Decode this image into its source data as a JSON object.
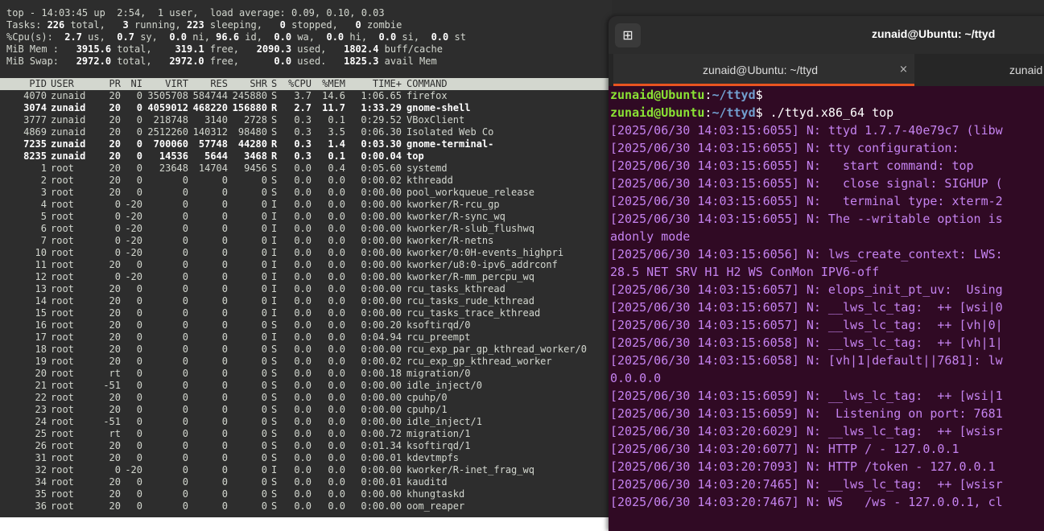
{
  "top": {
    "header_lines": [
      "top - 14:03:45 up  2:54,  1 user,  load average: 0.09, 0.10, 0.03",
      "Tasks: 226 total,   3 running, 223 sleeping,   0 stopped,   0 zombie",
      "%Cpu(s):  2.7 us,  0.7 sy,  0.0 ni, 96.6 id,  0.0 wa,  0.0 hi,  0.0 si,  0.0 st",
      "MiB Mem :   3915.6 total,    319.1 free,   2090.3 used,   1802.4 buff/cache",
      "MiB Swap:   2972.0 total,   2972.0 free,      0.0 used.   1825.3 avail Mem"
    ],
    "columns": [
      "PID",
      "USER",
      "PR",
      "NI",
      "VIRT",
      "RES",
      "SHR",
      "S",
      "%CPU",
      "%MEM",
      "TIME+",
      "COMMAND"
    ],
    "processes": [
      {
        "pid": "4070",
        "user": "zunaid",
        "pr": "20",
        "ni": "0",
        "virt": "3505708",
        "res": "584744",
        "shr": "245880",
        "s": "S",
        "cpu": "3.7",
        "mem": "14.6",
        "time": "1:06.65",
        "cmd": "firefox",
        "bold": false
      },
      {
        "pid": "3074",
        "user": "zunaid",
        "pr": "20",
        "ni": "0",
        "virt": "4059012",
        "res": "468220",
        "shr": "156880",
        "s": "R",
        "cpu": "2.7",
        "mem": "11.7",
        "time": "1:33.29",
        "cmd": "gnome-shell",
        "bold": true
      },
      {
        "pid": "3777",
        "user": "zunaid",
        "pr": "20",
        "ni": "0",
        "virt": "218748",
        "res": "3140",
        "shr": "2728",
        "s": "S",
        "cpu": "0.3",
        "mem": "0.1",
        "time": "0:29.52",
        "cmd": "VBoxClient",
        "bold": false
      },
      {
        "pid": "4869",
        "user": "zunaid",
        "pr": "20",
        "ni": "0",
        "virt": "2512260",
        "res": "140312",
        "shr": "98480",
        "s": "S",
        "cpu": "0.3",
        "mem": "3.5",
        "time": "0:06.30",
        "cmd": "Isolated Web Co",
        "bold": false
      },
      {
        "pid": "7235",
        "user": "zunaid",
        "pr": "20",
        "ni": "0",
        "virt": "700060",
        "res": "57748",
        "shr": "44280",
        "s": "R",
        "cpu": "0.3",
        "mem": "1.4",
        "time": "0:03.30",
        "cmd": "gnome-terminal-",
        "bold": true
      },
      {
        "pid": "8235",
        "user": "zunaid",
        "pr": "20",
        "ni": "0",
        "virt": "14536",
        "res": "5644",
        "shr": "3468",
        "s": "R",
        "cpu": "0.3",
        "mem": "0.1",
        "time": "0:00.04",
        "cmd": "top",
        "bold": true
      },
      {
        "pid": "1",
        "user": "root",
        "pr": "20",
        "ni": "0",
        "virt": "23648",
        "res": "14704",
        "shr": "9456",
        "s": "S",
        "cpu": "0.0",
        "mem": "0.4",
        "time": "0:05.60",
        "cmd": "systemd",
        "bold": false
      },
      {
        "pid": "2",
        "user": "root",
        "pr": "20",
        "ni": "0",
        "virt": "0",
        "res": "0",
        "shr": "0",
        "s": "S",
        "cpu": "0.0",
        "mem": "0.0",
        "time": "0:00.02",
        "cmd": "kthreadd",
        "bold": false
      },
      {
        "pid": "3",
        "user": "root",
        "pr": "20",
        "ni": "0",
        "virt": "0",
        "res": "0",
        "shr": "0",
        "s": "S",
        "cpu": "0.0",
        "mem": "0.0",
        "time": "0:00.00",
        "cmd": "pool_workqueue_release",
        "bold": false
      },
      {
        "pid": "4",
        "user": "root",
        "pr": "0",
        "ni": "-20",
        "virt": "0",
        "res": "0",
        "shr": "0",
        "s": "I",
        "cpu": "0.0",
        "mem": "0.0",
        "time": "0:00.00",
        "cmd": "kworker/R-rcu_gp",
        "bold": false
      },
      {
        "pid": "5",
        "user": "root",
        "pr": "0",
        "ni": "-20",
        "virt": "0",
        "res": "0",
        "shr": "0",
        "s": "I",
        "cpu": "0.0",
        "mem": "0.0",
        "time": "0:00.00",
        "cmd": "kworker/R-sync_wq",
        "bold": false
      },
      {
        "pid": "6",
        "user": "root",
        "pr": "0",
        "ni": "-20",
        "virt": "0",
        "res": "0",
        "shr": "0",
        "s": "I",
        "cpu": "0.0",
        "mem": "0.0",
        "time": "0:00.00",
        "cmd": "kworker/R-slub_flushwq",
        "bold": false
      },
      {
        "pid": "7",
        "user": "root",
        "pr": "0",
        "ni": "-20",
        "virt": "0",
        "res": "0",
        "shr": "0",
        "s": "I",
        "cpu": "0.0",
        "mem": "0.0",
        "time": "0:00.00",
        "cmd": "kworker/R-netns",
        "bold": false
      },
      {
        "pid": "10",
        "user": "root",
        "pr": "0",
        "ni": "-20",
        "virt": "0",
        "res": "0",
        "shr": "0",
        "s": "I",
        "cpu": "0.0",
        "mem": "0.0",
        "time": "0:00.00",
        "cmd": "kworker/0:0H-events_highpri",
        "bold": false
      },
      {
        "pid": "11",
        "user": "root",
        "pr": "20",
        "ni": "0",
        "virt": "0",
        "res": "0",
        "shr": "0",
        "s": "I",
        "cpu": "0.0",
        "mem": "0.0",
        "time": "0:00.00",
        "cmd": "kworker/u8:0-ipv6_addrconf",
        "bold": false
      },
      {
        "pid": "12",
        "user": "root",
        "pr": "0",
        "ni": "-20",
        "virt": "0",
        "res": "0",
        "shr": "0",
        "s": "I",
        "cpu": "0.0",
        "mem": "0.0",
        "time": "0:00.00",
        "cmd": "kworker/R-mm_percpu_wq",
        "bold": false
      },
      {
        "pid": "13",
        "user": "root",
        "pr": "20",
        "ni": "0",
        "virt": "0",
        "res": "0",
        "shr": "0",
        "s": "I",
        "cpu": "0.0",
        "mem": "0.0",
        "time": "0:00.00",
        "cmd": "rcu_tasks_kthread",
        "bold": false
      },
      {
        "pid": "14",
        "user": "root",
        "pr": "20",
        "ni": "0",
        "virt": "0",
        "res": "0",
        "shr": "0",
        "s": "I",
        "cpu": "0.0",
        "mem": "0.0",
        "time": "0:00.00",
        "cmd": "rcu_tasks_rude_kthread",
        "bold": false
      },
      {
        "pid": "15",
        "user": "root",
        "pr": "20",
        "ni": "0",
        "virt": "0",
        "res": "0",
        "shr": "0",
        "s": "I",
        "cpu": "0.0",
        "mem": "0.0",
        "time": "0:00.00",
        "cmd": "rcu_tasks_trace_kthread",
        "bold": false
      },
      {
        "pid": "16",
        "user": "root",
        "pr": "20",
        "ni": "0",
        "virt": "0",
        "res": "0",
        "shr": "0",
        "s": "S",
        "cpu": "0.0",
        "mem": "0.0",
        "time": "0:00.20",
        "cmd": "ksoftirqd/0",
        "bold": false
      },
      {
        "pid": "17",
        "user": "root",
        "pr": "20",
        "ni": "0",
        "virt": "0",
        "res": "0",
        "shr": "0",
        "s": "I",
        "cpu": "0.0",
        "mem": "0.0",
        "time": "0:04.94",
        "cmd": "rcu_preempt",
        "bold": false
      },
      {
        "pid": "18",
        "user": "root",
        "pr": "20",
        "ni": "0",
        "virt": "0",
        "res": "0",
        "shr": "0",
        "s": "S",
        "cpu": "0.0",
        "mem": "0.0",
        "time": "0:00.00",
        "cmd": "rcu_exp_par_gp_kthread_worker/0",
        "bold": false
      },
      {
        "pid": "19",
        "user": "root",
        "pr": "20",
        "ni": "0",
        "virt": "0",
        "res": "0",
        "shr": "0",
        "s": "S",
        "cpu": "0.0",
        "mem": "0.0",
        "time": "0:00.02",
        "cmd": "rcu_exp_gp_kthread_worker",
        "bold": false
      },
      {
        "pid": "20",
        "user": "root",
        "pr": "rt",
        "ni": "0",
        "virt": "0",
        "res": "0",
        "shr": "0",
        "s": "S",
        "cpu": "0.0",
        "mem": "0.0",
        "time": "0:00.18",
        "cmd": "migration/0",
        "bold": false
      },
      {
        "pid": "21",
        "user": "root",
        "pr": "-51",
        "ni": "0",
        "virt": "0",
        "res": "0",
        "shr": "0",
        "s": "S",
        "cpu": "0.0",
        "mem": "0.0",
        "time": "0:00.00",
        "cmd": "idle_inject/0",
        "bold": false
      },
      {
        "pid": "22",
        "user": "root",
        "pr": "20",
        "ni": "0",
        "virt": "0",
        "res": "0",
        "shr": "0",
        "s": "S",
        "cpu": "0.0",
        "mem": "0.0",
        "time": "0:00.00",
        "cmd": "cpuhp/0",
        "bold": false
      },
      {
        "pid": "23",
        "user": "root",
        "pr": "20",
        "ni": "0",
        "virt": "0",
        "res": "0",
        "shr": "0",
        "s": "S",
        "cpu": "0.0",
        "mem": "0.0",
        "time": "0:00.00",
        "cmd": "cpuhp/1",
        "bold": false
      },
      {
        "pid": "24",
        "user": "root",
        "pr": "-51",
        "ni": "0",
        "virt": "0",
        "res": "0",
        "shr": "0",
        "s": "S",
        "cpu": "0.0",
        "mem": "0.0",
        "time": "0:00.00",
        "cmd": "idle_inject/1",
        "bold": false
      },
      {
        "pid": "25",
        "user": "root",
        "pr": "rt",
        "ni": "0",
        "virt": "0",
        "res": "0",
        "shr": "0",
        "s": "S",
        "cpu": "0.0",
        "mem": "0.0",
        "time": "0:00.72",
        "cmd": "migration/1",
        "bold": false
      },
      {
        "pid": "26",
        "user": "root",
        "pr": "20",
        "ni": "0",
        "virt": "0",
        "res": "0",
        "shr": "0",
        "s": "S",
        "cpu": "0.0",
        "mem": "0.0",
        "time": "0:01.34",
        "cmd": "ksoftirqd/1",
        "bold": false
      },
      {
        "pid": "31",
        "user": "root",
        "pr": "20",
        "ni": "0",
        "virt": "0",
        "res": "0",
        "shr": "0",
        "s": "S",
        "cpu": "0.0",
        "mem": "0.0",
        "time": "0:00.01",
        "cmd": "kdevtmpfs",
        "bold": false
      },
      {
        "pid": "32",
        "user": "root",
        "pr": "0",
        "ni": "-20",
        "virt": "0",
        "res": "0",
        "shr": "0",
        "s": "I",
        "cpu": "0.0",
        "mem": "0.0",
        "time": "0:00.00",
        "cmd": "kworker/R-inet_frag_wq",
        "bold": false
      },
      {
        "pid": "34",
        "user": "root",
        "pr": "20",
        "ni": "0",
        "virt": "0",
        "res": "0",
        "shr": "0",
        "s": "S",
        "cpu": "0.0",
        "mem": "0.0",
        "time": "0:00.01",
        "cmd": "kauditd",
        "bold": false
      },
      {
        "pid": "35",
        "user": "root",
        "pr": "20",
        "ni": "0",
        "virt": "0",
        "res": "0",
        "shr": "0",
        "s": "S",
        "cpu": "0.0",
        "mem": "0.0",
        "time": "0:00.00",
        "cmd": "khungtaskd",
        "bold": false
      },
      {
        "pid": "36",
        "user": "root",
        "pr": "20",
        "ni": "0",
        "virt": "0",
        "res": "0",
        "shr": "0",
        "s": "S",
        "cpu": "0.0",
        "mem": "0.0",
        "time": "0:00.00",
        "cmd": "oom_reaper",
        "bold": false
      }
    ]
  },
  "terminal": {
    "window_title": "zunaid@Ubuntu: ~/ttyd",
    "new_tab_icon": "new-tab-icon",
    "tabs": [
      {
        "label": "zunaid@Ubuntu: ~/ttyd",
        "close": "×",
        "active": true
      },
      {
        "label": "zunaid",
        "active": false
      }
    ],
    "prompt": {
      "user": "zunaid@Ubuntu",
      "sep": ":",
      "path": "~/ttyd",
      "dollar": "$"
    },
    "command": " ./ttyd.x86_64 top",
    "log_lines": [
      "[2025/06/30 14:03:15:6055] N: ttyd 1.7.7-40e79c7 (libw",
      "[2025/06/30 14:03:15:6055] N: tty configuration:",
      "[2025/06/30 14:03:15:6055] N:   start command: top",
      "[2025/06/30 14:03:15:6055] N:   close signal: SIGHUP (",
      "[2025/06/30 14:03:15:6055] N:   terminal type: xterm-2",
      "[2025/06/30 14:03:15:6055] N: The --writable option is",
      "adonly mode",
      "[2025/06/30 14:03:15:6056] N: lws_create_context: LWS:",
      "28.5 NET SRV H1 H2 WS ConMon IPV6-off",
      "[2025/06/30 14:03:15:6057] N: elops_init_pt_uv:  Using",
      "[2025/06/30 14:03:15:6057] N: __lws_lc_tag:  ++ [wsi|0",
      "[2025/06/30 14:03:15:6057] N: __lws_lc_tag:  ++ [vh|0|",
      "[2025/06/30 14:03:15:6058] N: __lws_lc_tag:  ++ [vh|1|",
      "[2025/06/30 14:03:15:6058] N: [vh|1|default||7681]: lw",
      "0.0.0.0",
      "[2025/06/30 14:03:15:6059] N: __lws_lc_tag:  ++ [wsi|1",
      "[2025/06/30 14:03:15:6059] N:  Listening on port: 7681",
      "[2025/06/30 14:03:20:6029] N: __lws_lc_tag:  ++ [wsisr",
      "[2025/06/30 14:03:20:6077] N: HTTP / - 127.0.0.1",
      "[2025/06/30 14:03:20:7093] N: HTTP /token - 127.0.0.1",
      "[2025/06/30 14:03:20:7465] N: __lws_lc_tag:  ++ [wsisr",
      "[2025/06/30 14:03:20:7467] N: WS   /ws - 127.0.0.1, cl"
    ]
  }
}
